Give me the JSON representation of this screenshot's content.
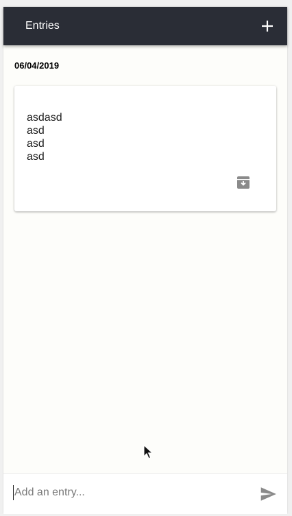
{
  "appbar": {
    "title": "Entries",
    "add_icon": "plus-icon"
  },
  "entries_group": {
    "date": "06/04/2019",
    "entries": [
      {
        "lines": [
          "asdasd",
          "asd",
          "asd",
          "asd"
        ],
        "action_icon": "archive-icon"
      }
    ]
  },
  "composer": {
    "value": "",
    "placeholder": "Add an entry...",
    "send_icon": "send-icon"
  },
  "colors": {
    "appbar_bg": "#2a2d36",
    "page_bg": "#fdfdfa",
    "icon_gray": "#8a8a8a"
  }
}
